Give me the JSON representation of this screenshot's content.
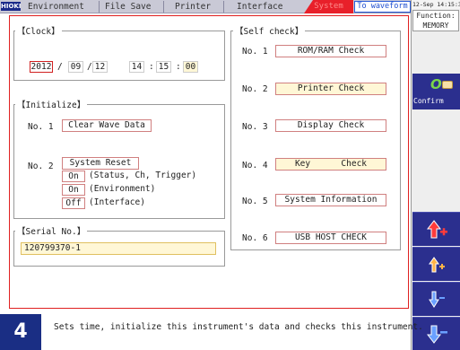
{
  "tabs": {
    "logo": "HIOKI",
    "environment": "Environment",
    "file_save": "File Save",
    "printer": "Printer",
    "interface": "Interface",
    "system": "System",
    "to_waveform": "To waveform"
  },
  "sidebar": {
    "datetime": "12-Sep 14:15:3",
    "function_label": "Function:",
    "function_value": "MEMORY",
    "confirm_label": "Confirm"
  },
  "clock": {
    "title": "【Clock】",
    "year": "2012",
    "month": "09",
    "day": "12",
    "hour": "14",
    "minute": "15",
    "second": "00",
    "sep_date": "/",
    "sep_time": ":"
  },
  "initialize": {
    "title": "【Initialize】",
    "no1_label": "No. 1",
    "no1_button": "Clear Wave Data",
    "no2_label": "No. 2",
    "no2_button": "System Reset",
    "opt1_value": "On",
    "opt1_desc": "(Status, Ch, Trigger)",
    "opt2_value": "On",
    "opt2_desc": "(Environment)",
    "opt3_value": "Off",
    "opt3_desc": "(Interface)"
  },
  "serial": {
    "title": "【Serial No.】",
    "value": "120799370-1"
  },
  "selfcheck": {
    "title": "【Self check】",
    "items": [
      {
        "label": "No. 1",
        "button": "ROM/RAM  Check"
      },
      {
        "label": "No. 2",
        "button": "Printer Check"
      },
      {
        "label": "No. 3",
        "button": "Display  Check"
      },
      {
        "label": "No. 4",
        "button": "Key      Check"
      },
      {
        "label": "No. 5",
        "button": "System Information"
      },
      {
        "label": "No. 6",
        "button": "USB HOST CHECK"
      }
    ]
  },
  "footer": {
    "badge": "4",
    "hint": "Sets time, initialize this instrument's data and checks this instrument."
  },
  "colors": {
    "accent_red": "#e8202a",
    "navy": "#2b2f8e",
    "highlight": "#fff7d6"
  }
}
